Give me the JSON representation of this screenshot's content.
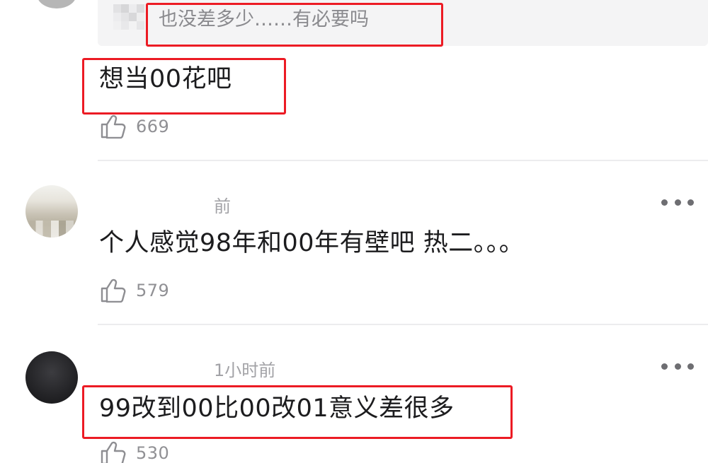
{
  "colors": {
    "highlight": "#ec1b24",
    "text_primary": "#1c1c1e",
    "text_secondary": "#909094",
    "divider": "#ececee",
    "quote_bg": "#f4f4f5"
  },
  "quoted_reply": {
    "text": "也没差多少……有必要吗"
  },
  "comments": [
    {
      "text": "想当00花吧",
      "like_icon": "thumbs-up-icon",
      "likes": "669",
      "highlighted": true
    },
    {
      "timestamp": "前",
      "text": "个人感觉98年和00年有壁吧  热二。。。",
      "like_icon": "thumbs-up-icon",
      "likes": "579",
      "more_icon": "more-dots-icon",
      "highlighted": false
    },
    {
      "timestamp": "1小时前",
      "text": "99改到00比00改01意义差很多",
      "like_icon": "thumbs-up-icon",
      "likes": "530",
      "more_icon": "more-dots-icon",
      "highlighted": true
    }
  ]
}
